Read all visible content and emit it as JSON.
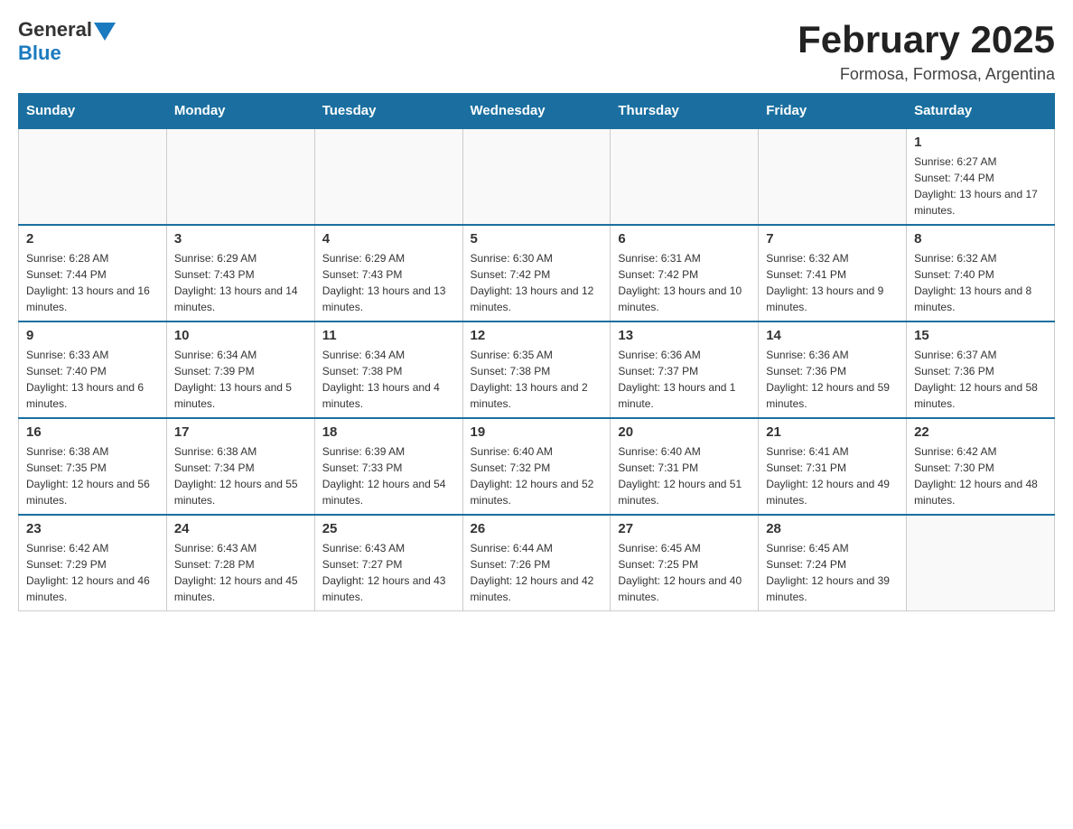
{
  "logo": {
    "general": "General",
    "blue": "Blue"
  },
  "title": "February 2025",
  "location": "Formosa, Formosa, Argentina",
  "days_of_week": [
    "Sunday",
    "Monday",
    "Tuesday",
    "Wednesday",
    "Thursday",
    "Friday",
    "Saturday"
  ],
  "weeks": [
    [
      {
        "day": "",
        "info": ""
      },
      {
        "day": "",
        "info": ""
      },
      {
        "day": "",
        "info": ""
      },
      {
        "day": "",
        "info": ""
      },
      {
        "day": "",
        "info": ""
      },
      {
        "day": "",
        "info": ""
      },
      {
        "day": "1",
        "info": "Sunrise: 6:27 AM\nSunset: 7:44 PM\nDaylight: 13 hours and 17 minutes."
      }
    ],
    [
      {
        "day": "2",
        "info": "Sunrise: 6:28 AM\nSunset: 7:44 PM\nDaylight: 13 hours and 16 minutes."
      },
      {
        "day": "3",
        "info": "Sunrise: 6:29 AM\nSunset: 7:43 PM\nDaylight: 13 hours and 14 minutes."
      },
      {
        "day": "4",
        "info": "Sunrise: 6:29 AM\nSunset: 7:43 PM\nDaylight: 13 hours and 13 minutes."
      },
      {
        "day": "5",
        "info": "Sunrise: 6:30 AM\nSunset: 7:42 PM\nDaylight: 13 hours and 12 minutes."
      },
      {
        "day": "6",
        "info": "Sunrise: 6:31 AM\nSunset: 7:42 PM\nDaylight: 13 hours and 10 minutes."
      },
      {
        "day": "7",
        "info": "Sunrise: 6:32 AM\nSunset: 7:41 PM\nDaylight: 13 hours and 9 minutes."
      },
      {
        "day": "8",
        "info": "Sunrise: 6:32 AM\nSunset: 7:40 PM\nDaylight: 13 hours and 8 minutes."
      }
    ],
    [
      {
        "day": "9",
        "info": "Sunrise: 6:33 AM\nSunset: 7:40 PM\nDaylight: 13 hours and 6 minutes."
      },
      {
        "day": "10",
        "info": "Sunrise: 6:34 AM\nSunset: 7:39 PM\nDaylight: 13 hours and 5 minutes."
      },
      {
        "day": "11",
        "info": "Sunrise: 6:34 AM\nSunset: 7:38 PM\nDaylight: 13 hours and 4 minutes."
      },
      {
        "day": "12",
        "info": "Sunrise: 6:35 AM\nSunset: 7:38 PM\nDaylight: 13 hours and 2 minutes."
      },
      {
        "day": "13",
        "info": "Sunrise: 6:36 AM\nSunset: 7:37 PM\nDaylight: 13 hours and 1 minute."
      },
      {
        "day": "14",
        "info": "Sunrise: 6:36 AM\nSunset: 7:36 PM\nDaylight: 12 hours and 59 minutes."
      },
      {
        "day": "15",
        "info": "Sunrise: 6:37 AM\nSunset: 7:36 PM\nDaylight: 12 hours and 58 minutes."
      }
    ],
    [
      {
        "day": "16",
        "info": "Sunrise: 6:38 AM\nSunset: 7:35 PM\nDaylight: 12 hours and 56 minutes."
      },
      {
        "day": "17",
        "info": "Sunrise: 6:38 AM\nSunset: 7:34 PM\nDaylight: 12 hours and 55 minutes."
      },
      {
        "day": "18",
        "info": "Sunrise: 6:39 AM\nSunset: 7:33 PM\nDaylight: 12 hours and 54 minutes."
      },
      {
        "day": "19",
        "info": "Sunrise: 6:40 AM\nSunset: 7:32 PM\nDaylight: 12 hours and 52 minutes."
      },
      {
        "day": "20",
        "info": "Sunrise: 6:40 AM\nSunset: 7:31 PM\nDaylight: 12 hours and 51 minutes."
      },
      {
        "day": "21",
        "info": "Sunrise: 6:41 AM\nSunset: 7:31 PM\nDaylight: 12 hours and 49 minutes."
      },
      {
        "day": "22",
        "info": "Sunrise: 6:42 AM\nSunset: 7:30 PM\nDaylight: 12 hours and 48 minutes."
      }
    ],
    [
      {
        "day": "23",
        "info": "Sunrise: 6:42 AM\nSunset: 7:29 PM\nDaylight: 12 hours and 46 minutes."
      },
      {
        "day": "24",
        "info": "Sunrise: 6:43 AM\nSunset: 7:28 PM\nDaylight: 12 hours and 45 minutes."
      },
      {
        "day": "25",
        "info": "Sunrise: 6:43 AM\nSunset: 7:27 PM\nDaylight: 12 hours and 43 minutes."
      },
      {
        "day": "26",
        "info": "Sunrise: 6:44 AM\nSunset: 7:26 PM\nDaylight: 12 hours and 42 minutes."
      },
      {
        "day": "27",
        "info": "Sunrise: 6:45 AM\nSunset: 7:25 PM\nDaylight: 12 hours and 40 minutes."
      },
      {
        "day": "28",
        "info": "Sunrise: 6:45 AM\nSunset: 7:24 PM\nDaylight: 12 hours and 39 minutes."
      },
      {
        "day": "",
        "info": ""
      }
    ]
  ]
}
